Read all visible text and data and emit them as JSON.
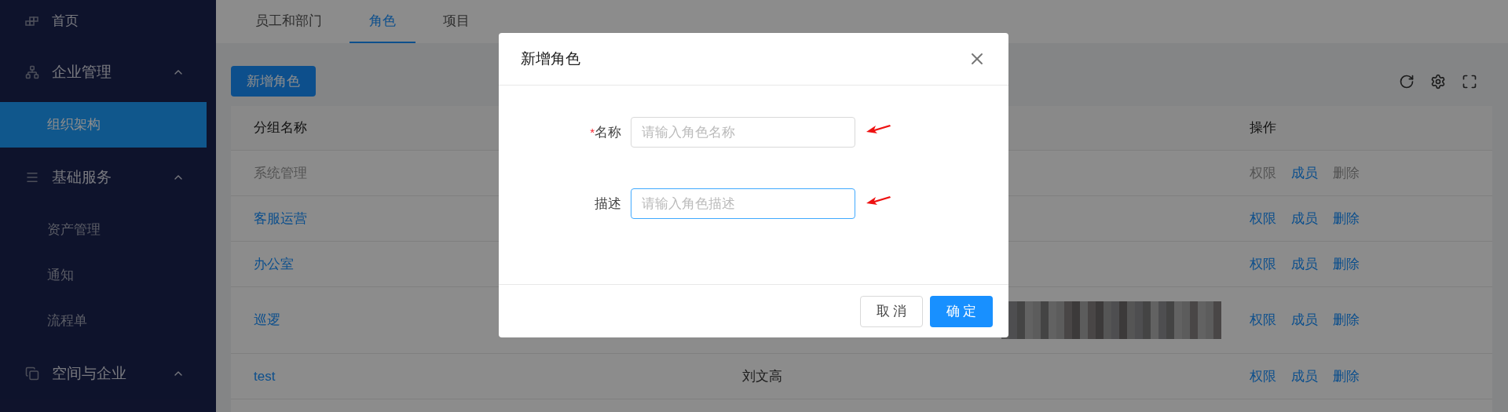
{
  "sidebar": {
    "items": [
      {
        "label": "首页",
        "kind": "link",
        "selected": false
      },
      {
        "label": "企业管理",
        "kind": "group",
        "expanded": true,
        "children": [
          {
            "label": "组织架构",
            "selected": true
          }
        ]
      },
      {
        "label": "基础服务",
        "kind": "group",
        "expanded": true,
        "children": [
          {
            "label": "资产管理",
            "selected": false
          },
          {
            "label": "通知",
            "selected": false
          },
          {
            "label": "流程单",
            "selected": false
          }
        ]
      },
      {
        "label": "空间与企业",
        "kind": "group",
        "expanded": true
      }
    ]
  },
  "tabs": [
    {
      "label": "员工和部门",
      "selected": false
    },
    {
      "label": "角色",
      "selected": true
    },
    {
      "label": "项目",
      "selected": false
    }
  ],
  "add_button": "新增角色",
  "table": {
    "columns": [
      {
        "label": "分组名称"
      },
      {
        "label": "操作"
      }
    ],
    "rows": [
      {
        "name": "系统管理",
        "disabled": true,
        "actions": [
          {
            "label": "权限",
            "disabled": true
          },
          {
            "label": "成员",
            "disabled": false
          },
          {
            "label": "删除",
            "disabled": true
          }
        ]
      },
      {
        "name": "客服运营",
        "disabled": false,
        "actions": [
          {
            "label": "权限",
            "disabled": false
          },
          {
            "label": "成员",
            "disabled": false
          },
          {
            "label": "删除",
            "disabled": false
          }
        ]
      },
      {
        "name": "办公室",
        "disabled": false,
        "actions": [
          {
            "label": "权限",
            "disabled": false
          },
          {
            "label": "成员",
            "disabled": false
          },
          {
            "label": "删除",
            "disabled": false
          }
        ]
      },
      {
        "name": "巡逻",
        "disabled": false,
        "redacted": true,
        "actions": [
          {
            "label": "权限",
            "disabled": false
          },
          {
            "label": "成员",
            "disabled": false
          },
          {
            "label": "删除",
            "disabled": false
          }
        ]
      },
      {
        "name": "test",
        "disabled": false,
        "column_3": "刘文高",
        "actions": [
          {
            "label": "权限",
            "disabled": false
          },
          {
            "label": "成员",
            "disabled": false
          },
          {
            "label": "删除",
            "disabled": false
          }
        ]
      }
    ]
  },
  "dialog": {
    "title": "新增角色",
    "fields": [
      {
        "label": "名称",
        "required": true,
        "placeholder": "请输入角色名称",
        "focused": false
      },
      {
        "label": "描述",
        "required": false,
        "placeholder": "请输入角色描述",
        "focused": true
      }
    ],
    "required_mark": "*",
    "buttons": [
      {
        "label": "取 消",
        "kind": "secondary"
      },
      {
        "label": "确 定",
        "kind": "primary"
      }
    ]
  }
}
